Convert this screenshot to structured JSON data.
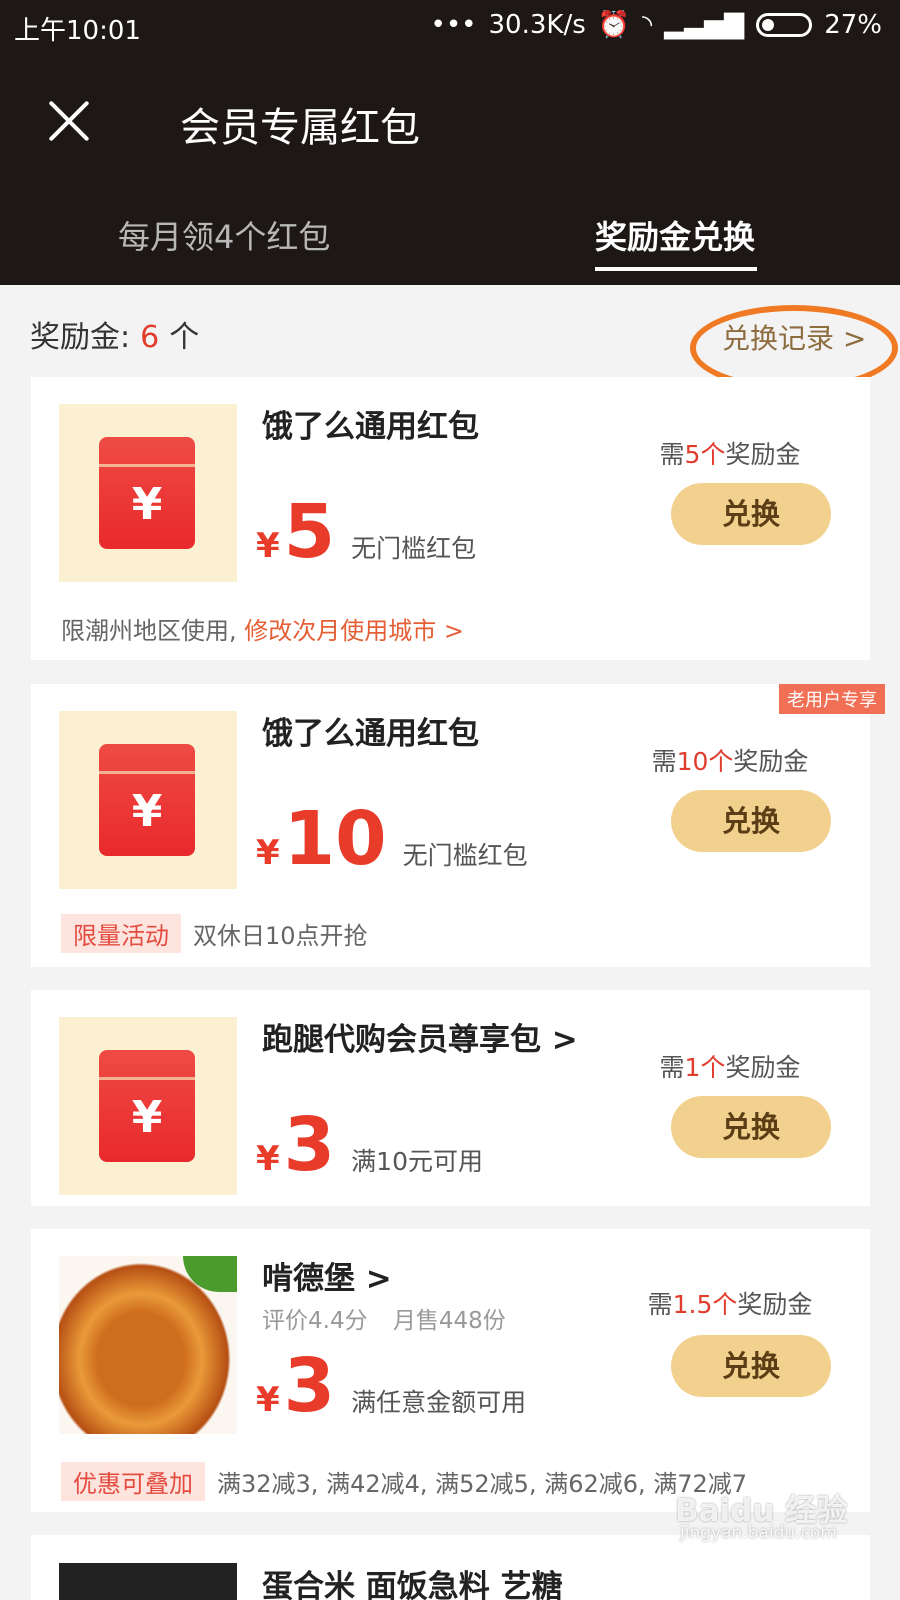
{
  "status_bar": {
    "time": "上午10:01",
    "speed": "30.3K/s",
    "battery": "27%",
    "icons": [
      "more-dots-icon",
      "alarm-icon",
      "wifi-icon",
      "signal-icon",
      "battery-icon"
    ]
  },
  "header": {
    "close_icon": "close-icon",
    "title": "会员专属红包",
    "tabs": [
      {
        "label": "每月领4个红包"
      },
      {
        "label": "奖励金兑换"
      }
    ]
  },
  "summary": {
    "bonus_label": "奖励金:",
    "bonus_count": "6",
    "bonus_unit": "个",
    "record_label": "兑换记录",
    "record_arrow": ">"
  },
  "cards": [
    {
      "name": "饿了么通用红包",
      "currency": "¥",
      "amount": "5",
      "condition": "无门槛红包",
      "need_prefix": "需",
      "need_count": "5个",
      "need_suffix": "奖励金",
      "button": "兑换",
      "bottom_text": "限潮州地区使用,",
      "bottom_link": "修改次月使用城市 >"
    },
    {
      "name": "饿了么通用红包",
      "badge": "老用户专享",
      "currency": "¥",
      "amount": "10",
      "condition": "无门槛红包",
      "need_prefix": "需",
      "need_count": "10个",
      "need_suffix": "奖励金",
      "button": "兑换",
      "tag": "限量活动",
      "bottom_text": "双休日10点开抢"
    },
    {
      "name": "跑腿代购会员尊享包 >",
      "currency": "¥",
      "amount": "3",
      "condition": "满10元可用",
      "need_prefix": "需",
      "need_count": "1个",
      "need_suffix": "奖励金",
      "button": "兑换"
    },
    {
      "name": "啃德堡 >",
      "subinfo": "评价4.4分 月售448份",
      "currency": "¥",
      "amount": "3",
      "condition": "满任意金额可用",
      "need_prefix": "需",
      "need_count": "1.5个",
      "need_suffix": "奖励金",
      "button": "兑换",
      "tag": "优惠可叠加",
      "bottom_text": "满32减3, 满42减4, 满52减5, 满62减6, 满72减7"
    }
  ],
  "partial_card": {
    "name": "蛋合米 面饭急料 艺糖"
  },
  "watermark": {
    "brand": "Baidu 经验",
    "url": "jingyan.baidu.com"
  }
}
